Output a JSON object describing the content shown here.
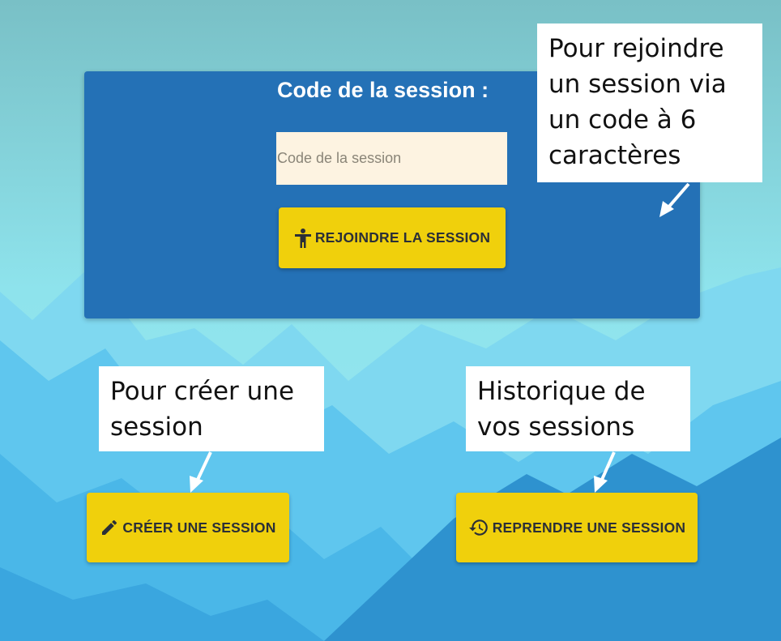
{
  "join_panel": {
    "title": "Code de la session :",
    "code_input": {
      "value": "",
      "placeholder": "Code de la session"
    },
    "join_button": {
      "label": "REJOINDRE LA SESSION",
      "icon": "person-arms-up-icon"
    }
  },
  "actions": {
    "create_button": {
      "label": "CRÉER UNE SESSION",
      "icon": "pencil-icon"
    },
    "resume_button": {
      "label": "REPRENDRE UNE SESSION",
      "icon": "history-icon"
    }
  },
  "annotations": {
    "join": [
      "Pour rejoindre",
      "un session via",
      "un code à 6",
      "caractères"
    ],
    "create": [
      "Pour créer une",
      "session"
    ],
    "history": [
      "Historique de",
      "vos sessions"
    ]
  },
  "colors": {
    "panel": "#2471b6",
    "button": "#f0d00c",
    "sky_top": "#7cc4c8",
    "sky_bottom": "#8fe4ee",
    "mountain_light": "#63c7ef",
    "mountain_dark": "#2b8bc8"
  }
}
